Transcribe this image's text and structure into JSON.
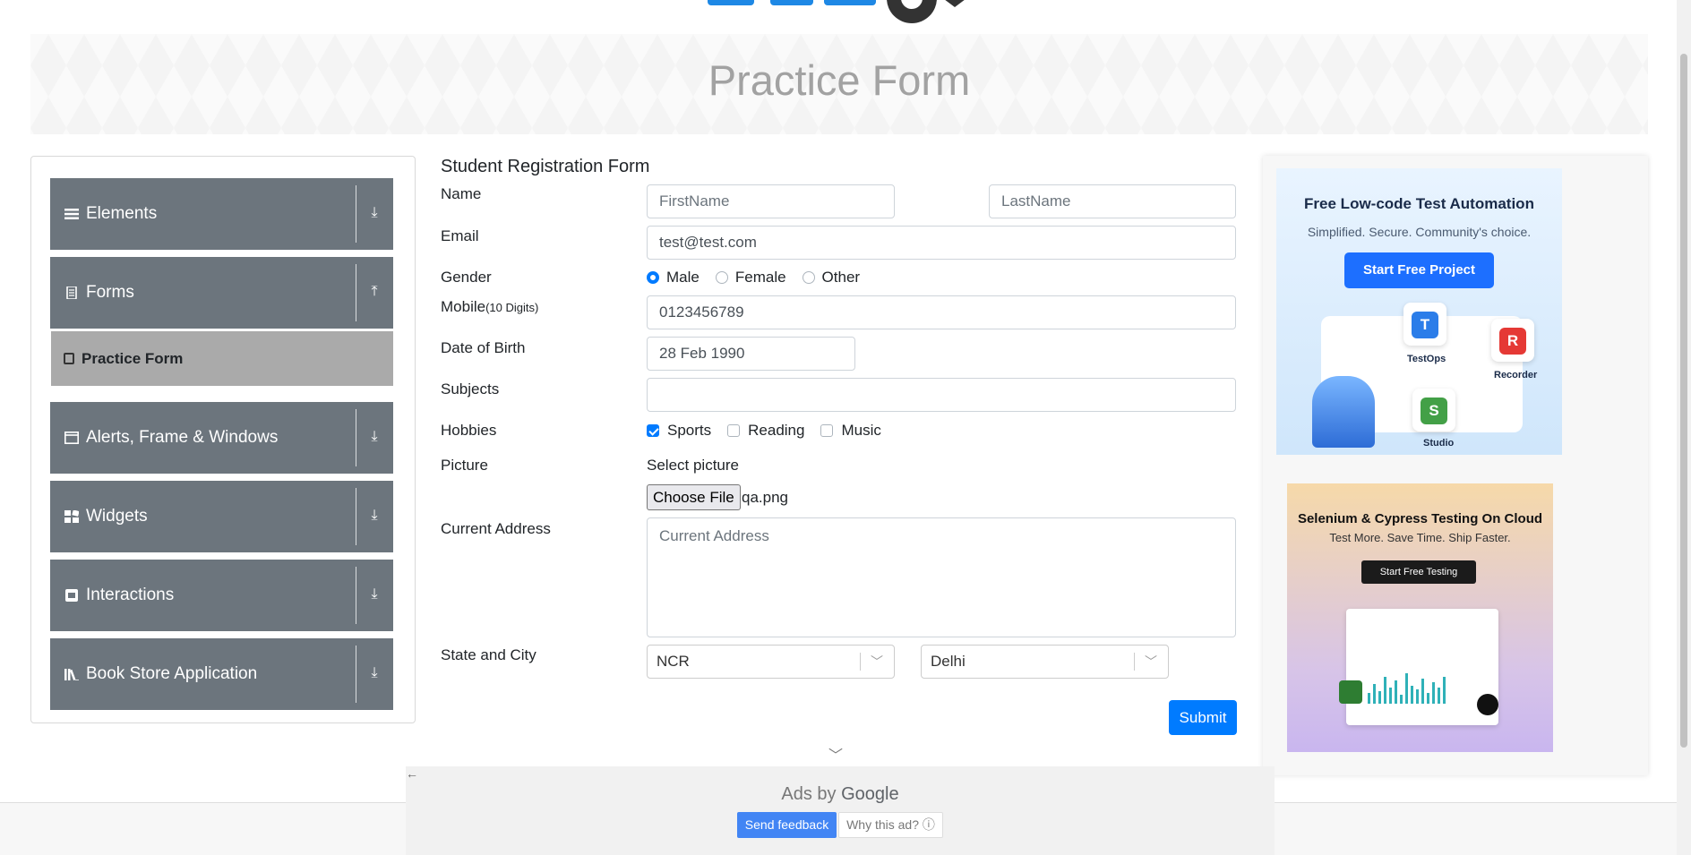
{
  "banner": {
    "title": "Practice Form"
  },
  "sidebar": {
    "groups": [
      {
        "label": "Elements",
        "icon": "menu-icon",
        "arrow": "⤓"
      },
      {
        "label": "Forms",
        "icon": "document-icon",
        "arrow": "⤒"
      },
      {
        "label": "Alerts, Frame & Windows",
        "icon": "window-icon",
        "arrow": "⤓"
      },
      {
        "label": "Widgets",
        "icon": "widgets-icon",
        "arrow": "⤓"
      },
      {
        "label": "Interactions",
        "icon": "interaction-icon",
        "arrow": "⤓"
      },
      {
        "label": "Book Store Application",
        "icon": "books-icon",
        "arrow": "⤓"
      }
    ],
    "active_item": "Practice Form"
  },
  "form": {
    "title": "Student Registration Form",
    "labels": {
      "name": "Name",
      "email": "Email",
      "gender": "Gender",
      "mobile": "Mobile",
      "mobile_hint": "(10 Digits)",
      "dob": "Date of Birth",
      "subjects": "Subjects",
      "hobbies": "Hobbies",
      "picture": "Picture",
      "address": "Current Address",
      "state_city": "State and City"
    },
    "first_name_placeholder": "FirstName",
    "last_name_placeholder": "LastName",
    "email_value": "test@test.com",
    "gender_options": [
      "Male",
      "Female",
      "Other"
    ],
    "gender_selected": "Male",
    "mobile_value": "0123456789",
    "dob_value": "28 Feb 1990",
    "subjects_value": "",
    "hobbies_options": [
      "Sports",
      "Reading",
      "Music"
    ],
    "hobbies_checked": [
      "Sports"
    ],
    "picture_caption": "Select picture",
    "file_button": "Choose File",
    "file_name": "qa.png",
    "address_placeholder": "Current Address",
    "state_value": "NCR",
    "city_value": "Delhi",
    "submit_label": "Submit"
  },
  "ads": {
    "ad1": {
      "title": "Free Low-code Test Automation",
      "subtitle": "Simplified. Secure. Community's choice.",
      "button": "Start Free Project",
      "tiles": [
        "TestOps",
        "Recorder",
        "Studio"
      ]
    },
    "ad2": {
      "title": "Selenium & Cypress Testing On Cloud",
      "subtitle": "Test More. Save Time. Ship Faster.",
      "button": "Start Free Testing"
    },
    "google": {
      "text_prefix": "Ads by",
      "brand": "Google",
      "feedback": "Send feedback",
      "why": "Why this ad? ⓘ"
    }
  },
  "colors": {
    "sidebar_group": "#6c757d",
    "active_item": "#aaaaaa",
    "primary": "#007bff"
  }
}
